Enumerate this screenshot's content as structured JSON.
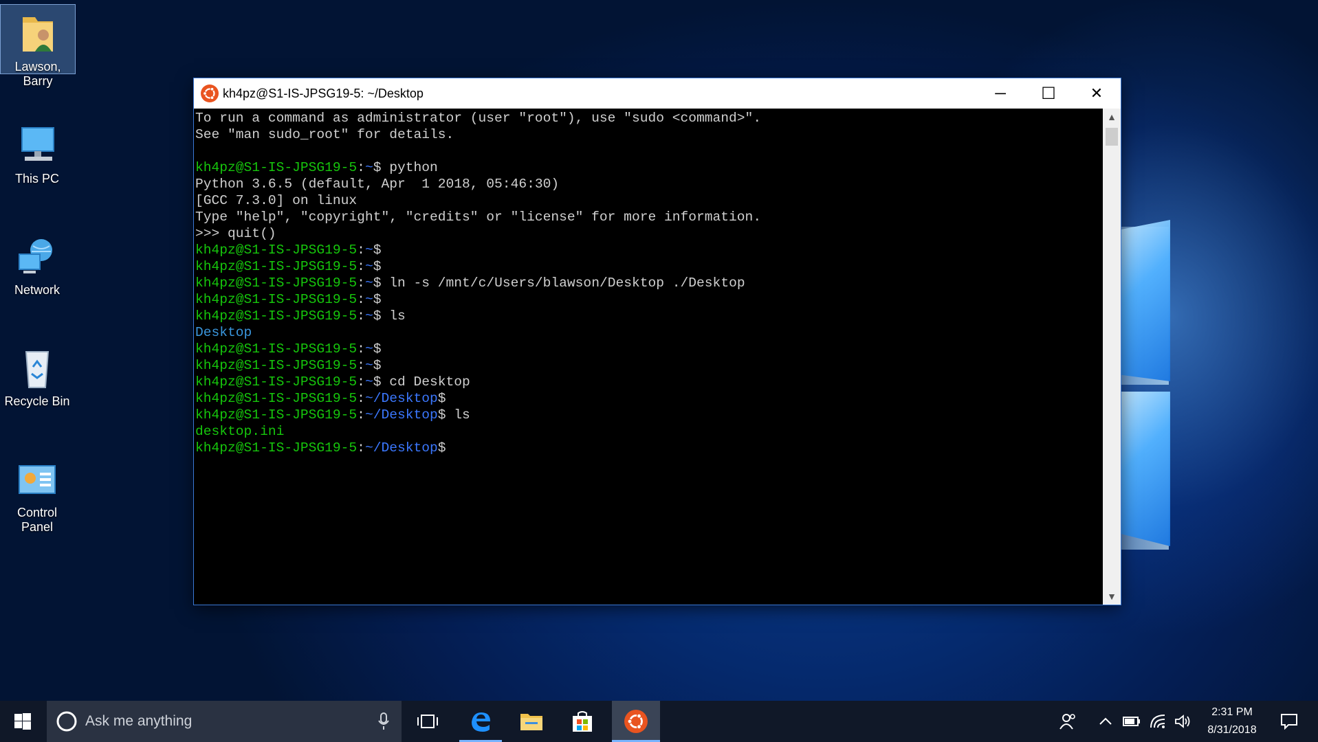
{
  "desktop": {
    "icons": [
      {
        "label": "Lawson, Barry",
        "icon": "user-folder-icon"
      },
      {
        "label": "This PC",
        "icon": "computer-icon"
      },
      {
        "label": "Network",
        "icon": "network-icon"
      },
      {
        "label": "Recycle Bin",
        "icon": "recycle-bin-icon"
      },
      {
        "label": "Control Panel",
        "icon": "control-panel-icon"
      }
    ]
  },
  "window": {
    "title": "kh4pz@S1-IS-JPSG19-5: ~/Desktop",
    "minimize": "─",
    "maximize": "☐",
    "close": "✕"
  },
  "terminal": {
    "user_host": "kh4pz@S1-IS-JPSG19-5",
    "intro": [
      "To run a command as administrator (user \"root\"), use \"sudo <command>\".",
      "See \"man sudo_root\" for details."
    ],
    "python_banner": [
      "Python 3.6.5 (default, Apr  1 2018, 05:46:30)",
      "[GCC 7.3.0] on linux",
      "Type \"help\", \"copyright\", \"credits\" or \"license\" for more information.",
      ">>> quit()"
    ],
    "cmd_python": "python",
    "cmd_ln": "ln -s /mnt/c/Users/blawson/Desktop ./Desktop",
    "cmd_ls": "ls",
    "cmd_cd": "cd Desktop",
    "out_desktop": "Desktop",
    "out_ini": "desktop.ini",
    "path_home": "~",
    "path_desktop": "~/Desktop"
  },
  "taskbar": {
    "search_placeholder": "Ask me anything",
    "time": "2:31 PM",
    "date": "8/31/2018"
  },
  "colors": {
    "prompt_user": "#16c60c",
    "prompt_path": "#3b78ff",
    "ls_dir": "#3a96dd",
    "ubuntu": "#e95420"
  }
}
